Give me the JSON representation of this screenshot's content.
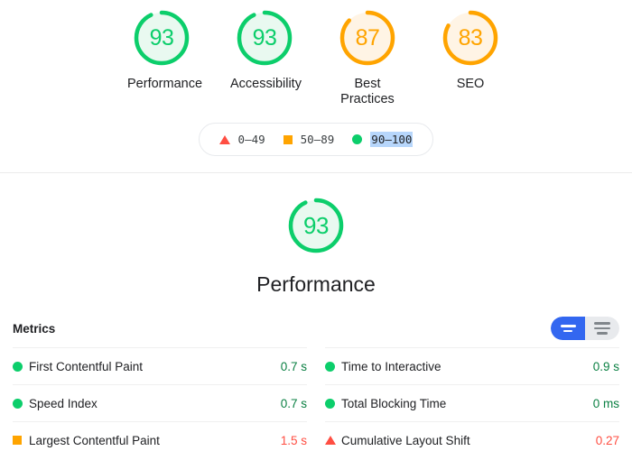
{
  "category_scores": [
    {
      "label": "Performance",
      "score": "93",
      "value": 93,
      "rating": "pass"
    },
    {
      "label": "Accessibility",
      "score": "93",
      "value": 93,
      "rating": "pass"
    },
    {
      "label": "Best Practices",
      "score": "87",
      "value": 87,
      "rating": "avg"
    },
    {
      "label": "SEO",
      "score": "83",
      "value": 83,
      "rating": "avg"
    }
  ],
  "legend": {
    "items": [
      {
        "icon": "triangle-icon",
        "range": "0–49"
      },
      {
        "icon": "square-icon",
        "range": "50–89"
      },
      {
        "icon": "circle-icon",
        "range": "90–100"
      }
    ],
    "selected_index": 2
  },
  "hero": {
    "score": "93",
    "value": 93,
    "rating": "pass",
    "title": "Performance"
  },
  "metrics": {
    "heading": "Metrics",
    "toggle": {
      "expanded_label": "expand-view-toggle",
      "collapsed_label": "list-view-toggle",
      "active": "expanded"
    },
    "columns": [
      [
        {
          "icon": "circle-icon",
          "rating": "pass",
          "name": "First Contentful Paint",
          "value": "0.7 s",
          "value_rating": "pass"
        },
        {
          "icon": "circle-icon",
          "rating": "pass",
          "name": "Speed Index",
          "value": "0.7 s",
          "value_rating": "pass"
        },
        {
          "icon": "square-icon",
          "rating": "avg",
          "name": "Largest Contentful Paint",
          "value": "1.5 s",
          "value_rating": "fail"
        }
      ],
      [
        {
          "icon": "circle-icon",
          "rating": "pass",
          "name": "Time to Interactive",
          "value": "0.9 s",
          "value_rating": "pass"
        },
        {
          "icon": "circle-icon",
          "rating": "pass",
          "name": "Total Blocking Time",
          "value": "0 ms",
          "value_rating": "pass"
        },
        {
          "icon": "triangle-icon",
          "rating": "fail",
          "name": "Cumulative Layout Shift",
          "value": "0.27",
          "value_rating": "fail"
        }
      ]
    ]
  },
  "colors": {
    "pass": "#0cce6b",
    "average": "#ffa400",
    "fail": "#ff4e42",
    "pass_text": "#0b8043",
    "accent_blue": "#3367f0",
    "selection": "#b7d6fb"
  }
}
